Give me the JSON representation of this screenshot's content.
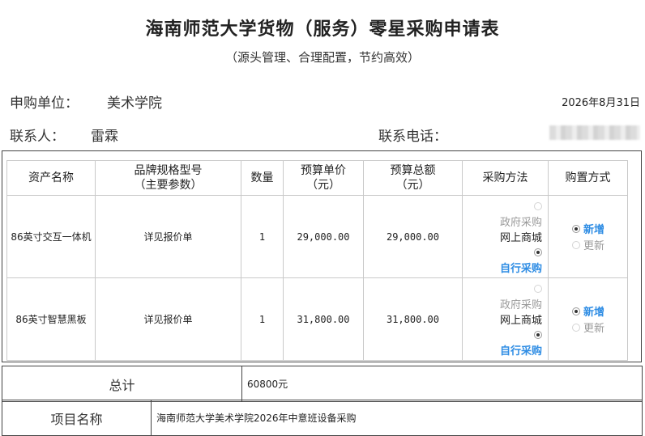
{
  "header": {
    "title": "海南师范大学货物（服务）零星采购申请表",
    "subtitle": "（源头管理、合理配置，节约高效）",
    "dept_label": "申购单位：",
    "dept_value": "美术学院",
    "date": "2026年8月31日",
    "contact_label": "联系人：",
    "contact_value": "雷霖",
    "phone_label": "联系电话："
  },
  "table": {
    "columns": [
      "资产名称",
      "品牌规格型号\n（主要参数）",
      "数量",
      "预算单价\n（元）",
      "预算总额\n（元）",
      "采购方法",
      "购置方式"
    ],
    "rows": [
      {
        "name": "86英寸交互一体机",
        "spec": "详见报价单",
        "qty": "1",
        "unit_price": "29,000.00",
        "total": "29,000.00",
        "methods": [
          "政府采购",
          "网上商城",
          "自行采购"
        ],
        "method_selected": "自行采购",
        "purchase_types": [
          "新增",
          "更新"
        ],
        "purchase_selected": "新增"
      },
      {
        "name": "86英寸智慧黑板",
        "spec": "详见报价单",
        "qty": "1",
        "unit_price": "31,800.00",
        "total": "31,800.00",
        "methods": [
          "政府采购",
          "网上商城",
          "自行采购"
        ],
        "method_selected": "自行采购",
        "purchase_types": [
          "新增",
          "更新"
        ],
        "purchase_selected": "新增"
      }
    ]
  },
  "footer": {
    "total_label": "总计",
    "total_value": "60800元",
    "project_label": "项目名称",
    "project_value": "海南师范大学美术学院2026年中意班设备采购"
  },
  "colors": {
    "selected": "#2f8de4",
    "disabled": "#9a9a9a",
    "border": "#c9c9c9"
  }
}
